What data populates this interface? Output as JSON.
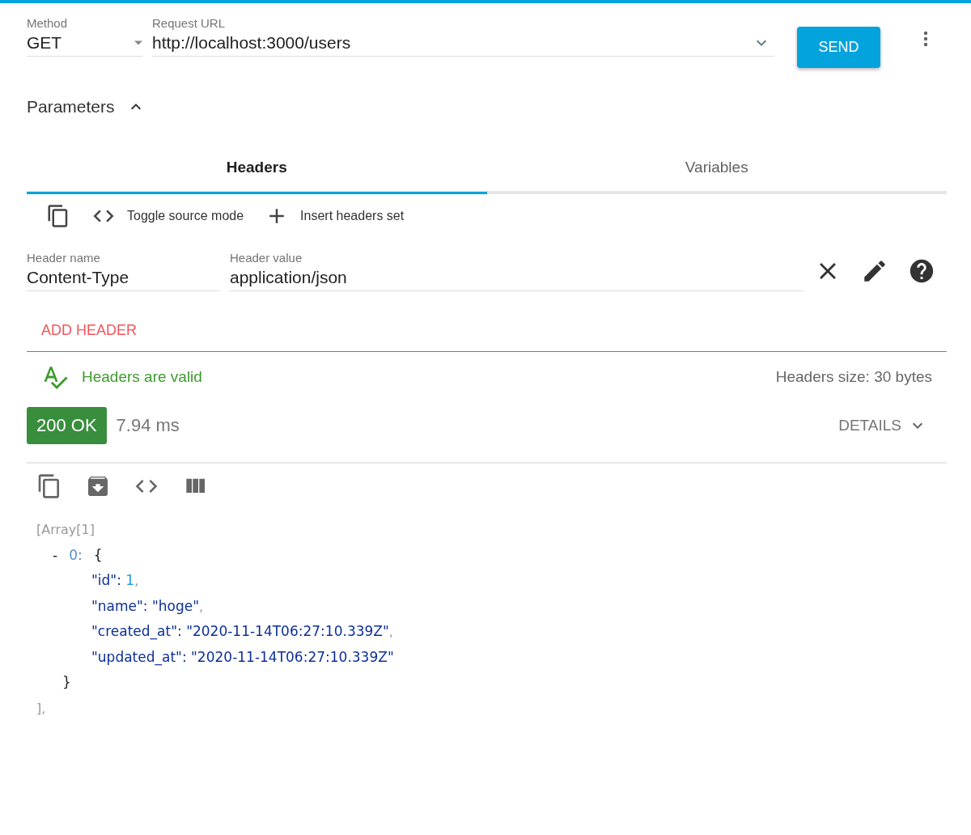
{
  "request": {
    "method": {
      "label": "Method",
      "value": "GET"
    },
    "url": {
      "label": "Request URL",
      "value": "http://localhost:3000/users"
    },
    "send_button": "SEND"
  },
  "parameters": {
    "title": "Parameters",
    "expanded": true
  },
  "tabs": [
    {
      "label": "Headers",
      "selected": true
    },
    {
      "label": "Variables",
      "selected": false
    }
  ],
  "headers_toolbar": [
    {
      "kind": "copy"
    },
    {
      "kind": "code",
      "label": "Toggle source mode"
    },
    {
      "kind": "plus",
      "label": "Insert headers set"
    }
  ],
  "headers": [
    {
      "name_label": "Header name",
      "name": "Content-Type",
      "value_label": "Header value",
      "value": "application/json"
    }
  ],
  "add_header": "ADD HEADER",
  "validation": {
    "valid": true,
    "message": "Headers are valid",
    "size": "Headers size: 30 bytes"
  },
  "response": {
    "status": "200 OK",
    "color": "#388e3c",
    "time": "7.94 ms",
    "details": "DETAILS"
  },
  "response_toolbar": [
    {
      "kind": "copy"
    },
    {
      "kind": "save"
    },
    {
      "kind": "code"
    },
    {
      "kind": "columns"
    }
  ],
  "json_view": {
    "header": "[Array[1]",
    "index_marker": "-",
    "index": "0:",
    "open": "{",
    "properties": [
      {
        "key": "\"id\":",
        "value": "1",
        "kind": "number",
        "trailing": ","
      },
      {
        "key": "\"name\":",
        "value": "\"hoge\"",
        "kind": "string",
        "trailing": ","
      },
      {
        "key": "\"created_at\":",
        "value": "\"2020-11-14T06:27:10.339Z\"",
        "kind": "string",
        "trailing": ","
      },
      {
        "key": "\"updated_at\":",
        "value": "\"2020-11-14T06:27:10.339Z\"",
        "kind": "string"
      }
    ],
    "close": "}",
    "end": "],"
  }
}
